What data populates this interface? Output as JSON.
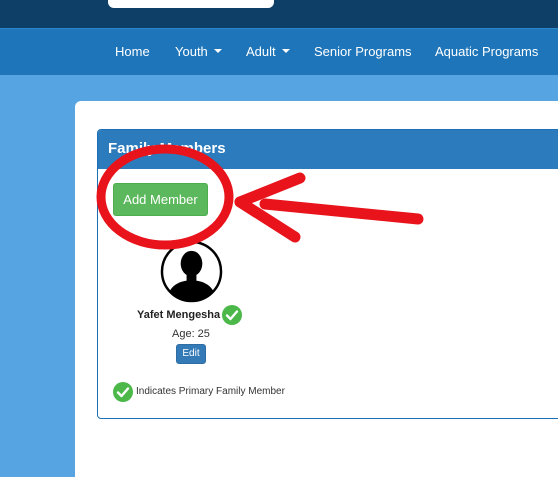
{
  "nav": {
    "items": [
      {
        "label": "Home"
      },
      {
        "label": "Youth",
        "has_caret": true
      },
      {
        "label": "Adult",
        "has_caret": true
      },
      {
        "label": "Senior Programs"
      },
      {
        "label": "Aquatic Programs"
      }
    ]
  },
  "panel": {
    "title": "Family Members",
    "add_button_label": "Add Member"
  },
  "member": {
    "name": "Yafet Mengesha",
    "age_text": "Age: 25",
    "edit_label": "Edit",
    "is_primary": true
  },
  "legend": {
    "text": "Indicates Primary Family Member"
  },
  "colors": {
    "topbar": "#0e3f66",
    "navbar": "#1e75b9",
    "page_background": "#56a4e2",
    "panel_header": "#2c7bbd",
    "add_button": "#5cb85c",
    "edit_button": "#337ab7",
    "check": "#4cb84a",
    "annotation": "#e8131b"
  },
  "icons": {
    "avatar": "person-silhouette-icon",
    "primary": "check-circle-icon",
    "annotation_arrow": "arrow-left-icon",
    "annotation_circle": "highlight-circle"
  }
}
